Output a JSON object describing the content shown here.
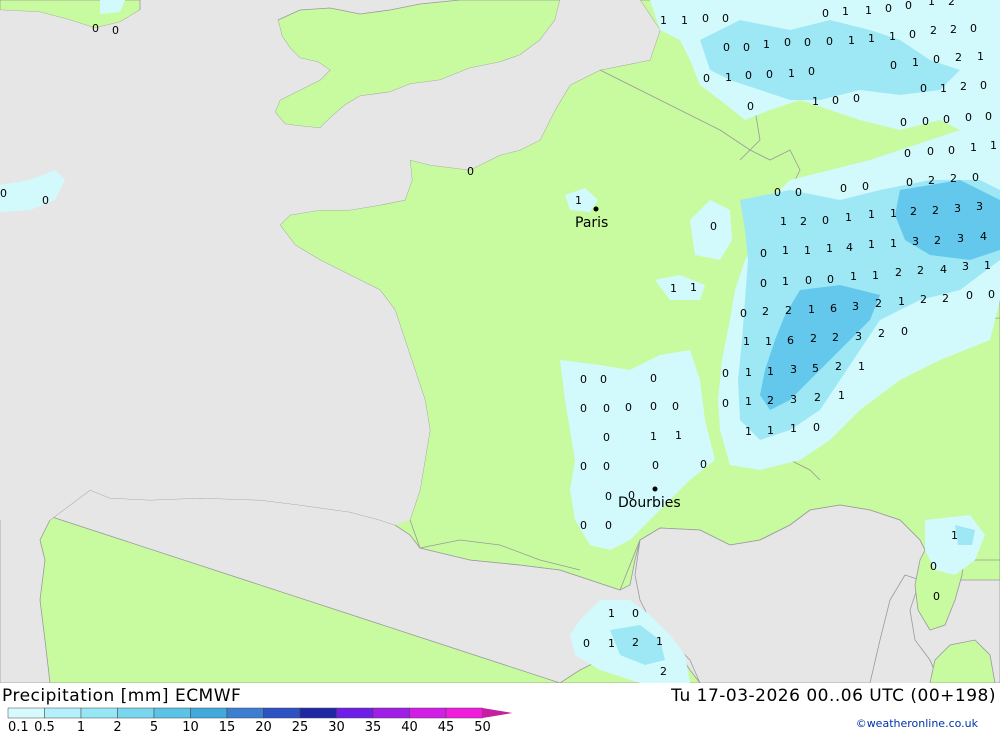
{
  "header": {
    "product": "Precipitation [mm] ECMWF",
    "datetime": "Tu 17-03-2026 00..06 UTC (00+198)",
    "credit": "©weatheronline.co.uk"
  },
  "cities": [
    {
      "name": "Paris"
    },
    {
      "name": "Dourbies"
    }
  ],
  "legend": {
    "ticks": [
      "0.1",
      "0.5",
      "1",
      "2",
      "5",
      "10",
      "15",
      "20",
      "25",
      "30",
      "35",
      "40",
      "45",
      "50"
    ],
    "colors": [
      "#d6fafe",
      "#b4f0fb",
      "#96e6f5",
      "#78d7ef",
      "#5ac3e6",
      "#41a9dc",
      "#3c7fd2",
      "#2d52c3",
      "#1e28a5",
      "#6e1ee6",
      "#a01ee6",
      "#d21ee6",
      "#f01edc",
      "#c81ea0"
    ]
  },
  "colors": {
    "sea": "#e6e6e6",
    "land": "#c8fa9f",
    "precip_light": "#d2fafc",
    "precip_mid": "#9ee8f5",
    "precip_heavy": "#64c8ec"
  },
  "precip_labels": [
    "0",
    "1",
    "0",
    "0",
    "1",
    "1",
    "0",
    "0",
    "1",
    "0",
    "1",
    "1",
    "0",
    "0",
    "2",
    "2",
    "0",
    "0",
    "1",
    "0",
    "1",
    "0",
    "1",
    "0",
    "0",
    "1",
    "2",
    "1",
    "0",
    "1",
    "0",
    "0",
    "1",
    "0",
    "1",
    "0",
    "0",
    "0",
    "1",
    "2",
    "0",
    "0",
    "0",
    "2",
    "0",
    "1",
    "0",
    "0",
    "1",
    "2",
    "0",
    "1",
    "1",
    "2",
    "3",
    "3",
    "1",
    "1",
    "1",
    "4",
    "1",
    "1",
    "3",
    "2",
    "3",
    "4",
    "0",
    "1",
    "1",
    "1",
    "1",
    "2",
    "2",
    "4",
    "3",
    "1",
    "0",
    "0",
    "1",
    "0",
    "0",
    "2",
    "2",
    "1",
    "6",
    "3",
    "2",
    "1",
    "2",
    "2",
    "0",
    "1",
    "6",
    "2",
    "3",
    "2",
    "1",
    "1",
    "3",
    "5",
    "2",
    "1",
    "0",
    "1",
    "2",
    "3",
    "2",
    "1",
    "1",
    "1",
    "1",
    "0",
    "0",
    "0",
    "0",
    "0",
    "0",
    "0",
    "0",
    "0",
    "0",
    "1",
    "1",
    "0",
    "0",
    "0",
    "0",
    "0",
    "0",
    "0",
    "0",
    "1",
    "0",
    "0",
    "1",
    "2",
    "1",
    "2",
    "1",
    "0",
    "1",
    "1",
    "0"
  ],
  "paris_label": "1",
  "map_labels_ne": [
    "0",
    "1",
    "1",
    "0",
    "1",
    "1",
    "0",
    "0",
    "1",
    "2",
    "0",
    "0",
    "1",
    "0",
    "0",
    "2",
    "1",
    "0",
    "0",
    "1",
    "0",
    "0",
    "0",
    "1",
    "0",
    "0",
    "0",
    "0",
    "0",
    "0",
    "1"
  ]
}
